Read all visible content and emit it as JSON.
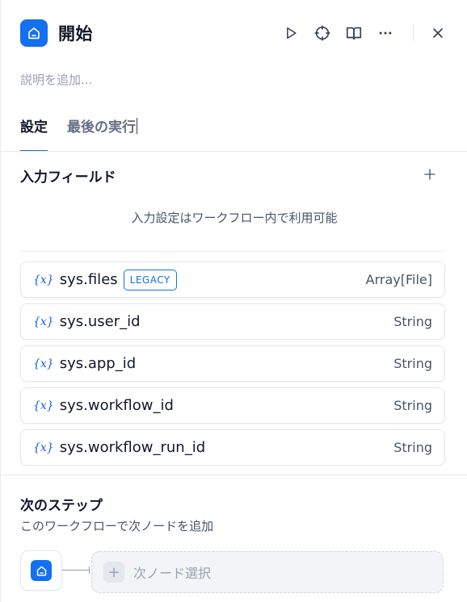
{
  "header": {
    "title": "開始",
    "icons": [
      "home-icon",
      "play-icon",
      "crosshair-icon",
      "book-icon",
      "more-icon",
      "close-icon"
    ]
  },
  "description": {
    "placeholder": "説明を追加..."
  },
  "tabs": [
    {
      "label": "設定",
      "active": true
    },
    {
      "label": "最後の実行",
      "active": false
    }
  ],
  "input_fields": {
    "title": "入力フィールド",
    "hint": "入力設定はワークフロー内で利用可能",
    "variables": [
      {
        "icon": "{x}",
        "name": "sys.files",
        "badge": "LEGACY",
        "type": "Array[File]"
      },
      {
        "icon": "{x}",
        "name": "sys.user_id",
        "badge": "",
        "type": "String"
      },
      {
        "icon": "{x}",
        "name": "sys.app_id",
        "badge": "",
        "type": "String"
      },
      {
        "icon": "{x}",
        "name": "sys.workflow_id",
        "badge": "",
        "type": "String"
      },
      {
        "icon": "{x}",
        "name": "sys.workflow_run_id",
        "badge": "",
        "type": "String"
      }
    ]
  },
  "next_step": {
    "title": "次のステップ",
    "description": "このワークフローで次ノードを追加",
    "select_label": "次ノード選択",
    "plus": "+"
  },
  "colors": {
    "accent": "#1570ef",
    "badge": "#1570ef",
    "text": "#101828",
    "muted": "#98a2b3"
  }
}
